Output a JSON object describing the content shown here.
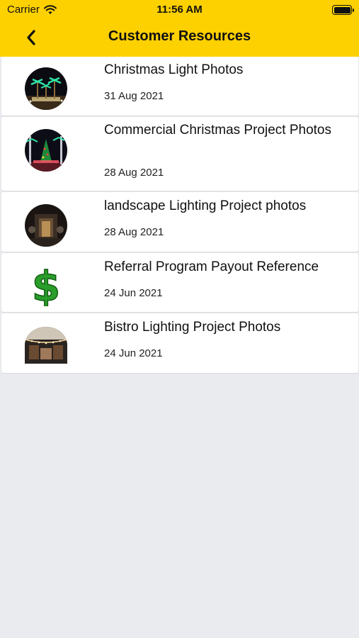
{
  "status_bar": {
    "carrier": "Carrier",
    "time": "11:56 AM"
  },
  "nav": {
    "title": "Customer Resources",
    "back_icon": "chevron-left-icon"
  },
  "resources": [
    {
      "title": "Christmas Light Photos",
      "date": "31 Aug 2021",
      "icon": "christmas-palms-photo"
    },
    {
      "title": "Commercial Christmas Project Photos",
      "date": "28 Aug 2021",
      "icon": "christmas-tree-plaza-photo"
    },
    {
      "title": "landscape Lighting Project photos",
      "date": "28 Aug 2021",
      "icon": "landscape-lighting-photo"
    },
    {
      "title": "Referral Program Payout Reference",
      "date": "24 Jun 2021",
      "icon": "dollar-sign-icon"
    },
    {
      "title": "Bistro Lighting Project Photos",
      "date": "24 Jun 2021",
      "icon": "bistro-lights-photo"
    }
  ],
  "colors": {
    "header": "#fdd000",
    "background": "#e9ebee",
    "card": "#ffffff",
    "dollar": "#2a9d2a"
  }
}
